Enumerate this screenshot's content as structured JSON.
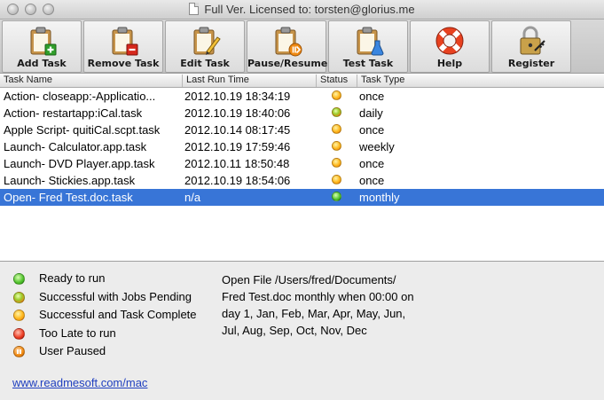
{
  "window": {
    "title": "Full Ver. Licensed to: torsten@glorius.me"
  },
  "toolbar": {
    "buttons": [
      {
        "label": "Add Task",
        "icon": "clipboard-add-icon"
      },
      {
        "label": "Remove Task",
        "icon": "clipboard-remove-icon"
      },
      {
        "label": "Edit Task",
        "icon": "clipboard-pencil-icon"
      },
      {
        "label": "Pause/Resume",
        "icon": "clipboard-pause-icon"
      },
      {
        "label": "Test Task",
        "icon": "clipboard-flask-icon"
      },
      {
        "label": "Help",
        "icon": "lifebuoy-icon"
      },
      {
        "label": "Register",
        "icon": "padlock-key-icon"
      }
    ]
  },
  "table": {
    "headers": {
      "name": "Task Name",
      "time": "Last Run Time",
      "status": "Status",
      "type": "Task Type"
    },
    "rows": [
      {
        "name": "Action- closeapp:-Applicatio...",
        "time": "2012.10.19 18:34:19",
        "status": "complete",
        "type": "once"
      },
      {
        "name": "Action- restartapp:iCal.task",
        "time": "2012.10.19 18:40:06",
        "status": "pending",
        "type": "daily"
      },
      {
        "name": "Apple Script- quitiCal.scpt.task",
        "time": "2012.10.14 08:17:45",
        "status": "complete",
        "type": "once"
      },
      {
        "name": "Launch- Calculator.app.task",
        "time": "2012.10.19 17:59:46",
        "status": "complete",
        "type": "weekly"
      },
      {
        "name": "Launch- DVD Player.app.task",
        "time": "2012.10.11 18:50:48",
        "status": "complete",
        "type": "once"
      },
      {
        "name": "Launch- Stickies.app.task",
        "time": "2012.10.19 18:54:06",
        "status": "complete",
        "type": "once"
      },
      {
        "name": "Open- Fred Test.doc.task",
        "time": "n/a",
        "status": "ready",
        "type": "monthly",
        "selected": true
      }
    ]
  },
  "legend": [
    {
      "status": "ready",
      "label": "Ready to run"
    },
    {
      "status": "pending",
      "label": "Successful with Jobs Pending"
    },
    {
      "status": "complete",
      "label": "Successful and Task Complete"
    },
    {
      "status": "late",
      "label": "Too Late to run"
    },
    {
      "status": "paused",
      "label": "User Paused"
    }
  ],
  "detail": {
    "text": "Open File /Users/fred/Documents/\nFred Test.doc monthly when 00:00 on\nday 1, Jan, Feb, Mar, Apr, May, Jun,\nJul, Aug, Sep, Oct, Nov, Dec"
  },
  "footer": {
    "link": "www.readmesoft.com/mac"
  },
  "colors": {
    "selection": "#3875d7",
    "link": "#1f3fbf"
  }
}
